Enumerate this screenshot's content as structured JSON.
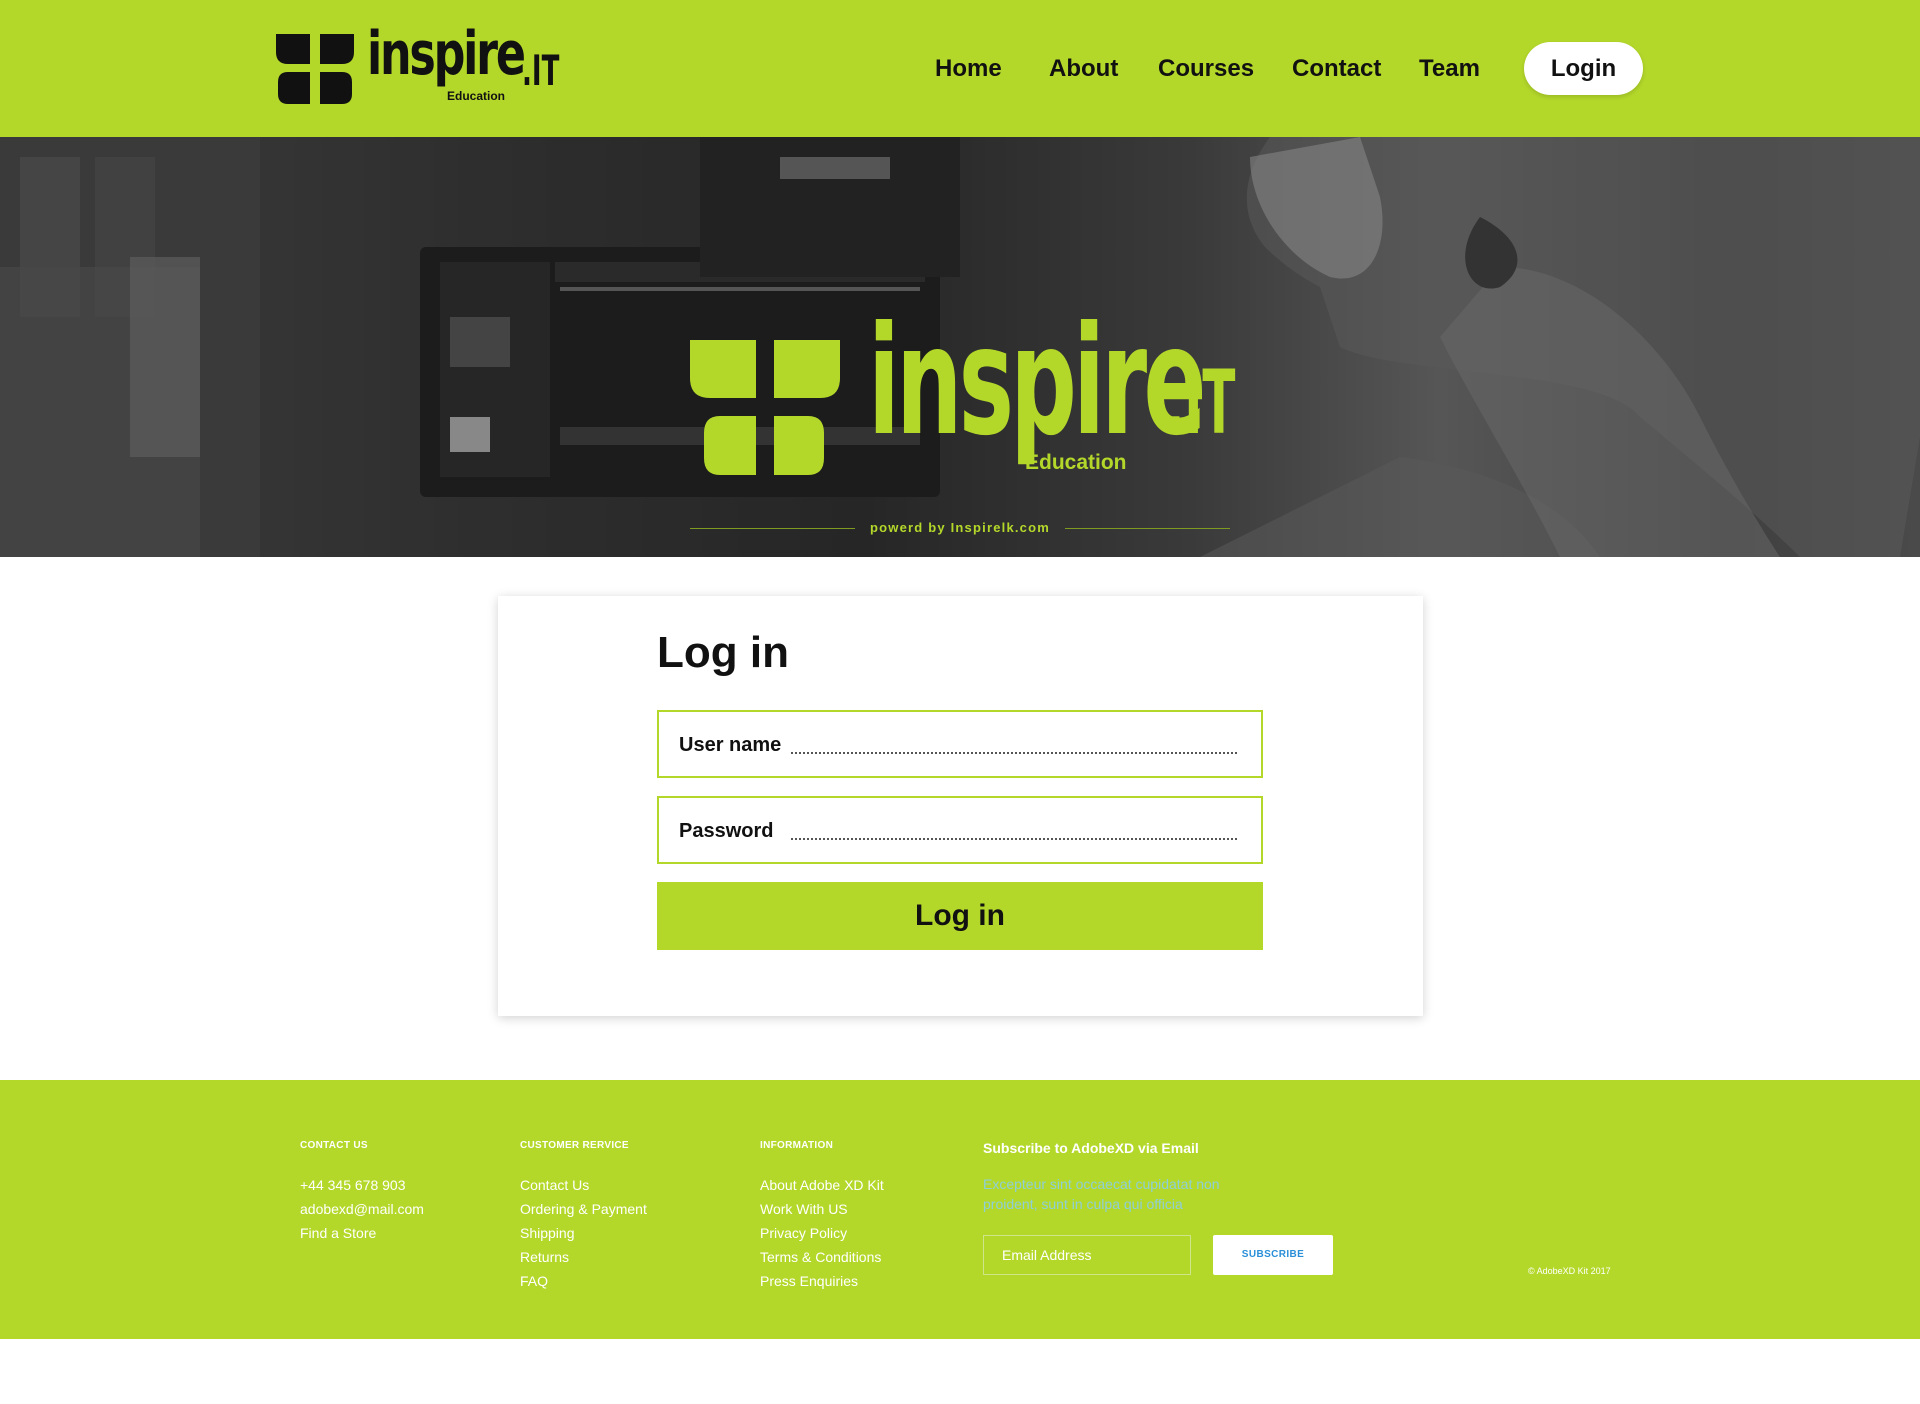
{
  "colors": {
    "accent": "#b4d82a",
    "white": "#ffffff",
    "text": "#111111",
    "subscribe_blue": "#2a8fd8"
  },
  "brand": {
    "name": "inspire",
    "tld": ".IT",
    "sub": "Education"
  },
  "nav": {
    "home": "Home",
    "about": "About",
    "courses": "Courses",
    "contact": "Contact",
    "team": "Team",
    "login": "Login"
  },
  "hero": {
    "name": "inspire",
    "tld": ".IT",
    "sub": "Education",
    "powered": "powerd by Inspirelk.com"
  },
  "login": {
    "title": "Log in",
    "username_label": "User name",
    "password_label": "Password",
    "submit_label": "Log in"
  },
  "footer": {
    "contact": {
      "heading": "CONTACT US",
      "items": [
        "+44 345 678 903",
        "adobexd@mail.com",
        "Find a Store"
      ]
    },
    "service": {
      "heading": "CUSTOMER RERVICE",
      "items": [
        "Contact Us",
        "Ordering & Payment",
        "Shipping",
        "Returns",
        "FAQ"
      ]
    },
    "info": {
      "heading": "INFORMATION",
      "items": [
        "About Adobe XD Kit",
        "Work With US",
        "Privacy Policy",
        "Terms & Conditions",
        "Press Enquiries"
      ]
    },
    "subscribe": {
      "title": "Subscribe to AdobeXD via Email",
      "text": "Excepteur sint occaecat cupidatat non proident, sunt in culpa qui officia",
      "email_placeholder": "Email Address",
      "button": "SUBSCRIBE"
    },
    "copyright": "© AdobeXD Kit 2017"
  }
}
